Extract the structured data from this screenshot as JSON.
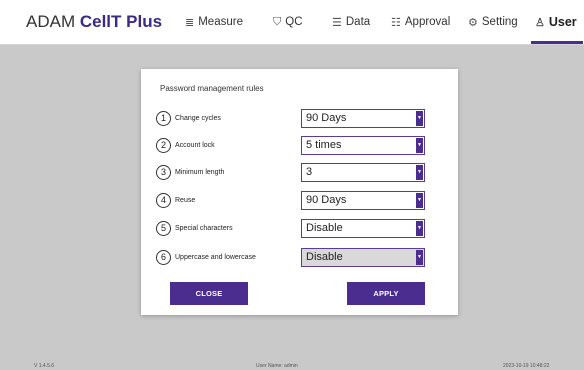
{
  "app": {
    "brand_prefix": "ADAM ",
    "brand_strong": "CellT Plus"
  },
  "nav": [
    {
      "label": "Measure",
      "icon": "list-icon",
      "glyph": "≣"
    },
    {
      "label": "QC",
      "icon": "shield-check-icon",
      "glyph": "⛉"
    },
    {
      "label": "Data",
      "icon": "list-icon",
      "glyph": "☰"
    },
    {
      "label": "Approval",
      "icon": "approval-list-icon",
      "glyph": "☷"
    },
    {
      "label": "Setting",
      "icon": "gear-icon",
      "glyph": "⚙"
    },
    {
      "label": "User",
      "icon": "user-icon",
      "glyph": "♙",
      "active": true
    }
  ],
  "modal": {
    "title": "Password management rules",
    "rules": [
      {
        "num": "1",
        "label": "Change cycles",
        "value": "90 Days"
      },
      {
        "num": "2",
        "label": "Account lock",
        "value": "5 times"
      },
      {
        "num": "3",
        "label": "Minimum length",
        "value": "3"
      },
      {
        "num": "4",
        "label": "Reuse",
        "value": "90 Days"
      },
      {
        "num": "5",
        "label": "Special characters",
        "value": "Disable"
      },
      {
        "num": "6",
        "label": "Uppercase and lowercase",
        "value": "Disable"
      }
    ],
    "close_label": "CLOSE",
    "apply_label": "APPLY"
  },
  "footer": {
    "version": "V 1.4.5.6",
    "user": "User Name: admin",
    "datetime": "2023-10-19 10:48:22"
  },
  "colors": {
    "accent": "#4b2d8f",
    "overlay": "#c9c9c9"
  }
}
